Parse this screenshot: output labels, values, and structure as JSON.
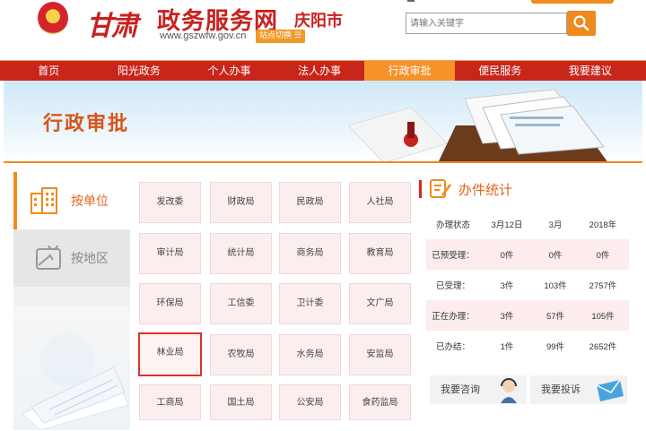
{
  "header": {
    "logo_text": "甘肃",
    "site_name": "政务服务网",
    "city": "庆阳市",
    "url": "www.gszwfw.gov.cn",
    "switch_label": "站点切换",
    "search_placeholder": "请输入关键字"
  },
  "nav": {
    "items": [
      "首页",
      "阳光政务",
      "个人办事",
      "法人办事",
      "行政审批",
      "便民服务",
      "我要建议"
    ],
    "active_index": 4
  },
  "banner": {
    "title": "行政审批"
  },
  "side_tabs": {
    "by_unit": "按单位",
    "by_area": "按地区",
    "active": "by_unit"
  },
  "departments": [
    [
      "发改委",
      "财政局",
      "民政局",
      "人社局"
    ],
    [
      "审计局",
      "统计局",
      "商务局",
      "教育局"
    ],
    [
      "环保局",
      "工信委",
      "卫计委",
      "文广局"
    ],
    [
      "林业局",
      "农牧局",
      "水务局",
      "安监局"
    ],
    [
      "工商局",
      "国土局",
      "公安局",
      "食药监局"
    ]
  ],
  "selected_department": "林业局",
  "stats": {
    "title": "办件统计",
    "header": [
      "办理状态",
      "3月12日",
      "3月",
      "2018年"
    ],
    "rows": [
      [
        "已预受理：",
        "0件",
        "0件",
        "0件"
      ],
      [
        "已受理：",
        "3件",
        "103件",
        "2757件"
      ],
      [
        "正在办理：",
        "3件",
        "57件",
        "105件"
      ],
      [
        "已办结：",
        "1件",
        "99件",
        "2652件"
      ]
    ]
  },
  "actions": {
    "consult": "我要咨询",
    "complain": "我要投诉"
  },
  "colors": {
    "brand_red": "#c8261b",
    "accent_orange": "#f08a1c",
    "title_orange": "#e4661a"
  }
}
